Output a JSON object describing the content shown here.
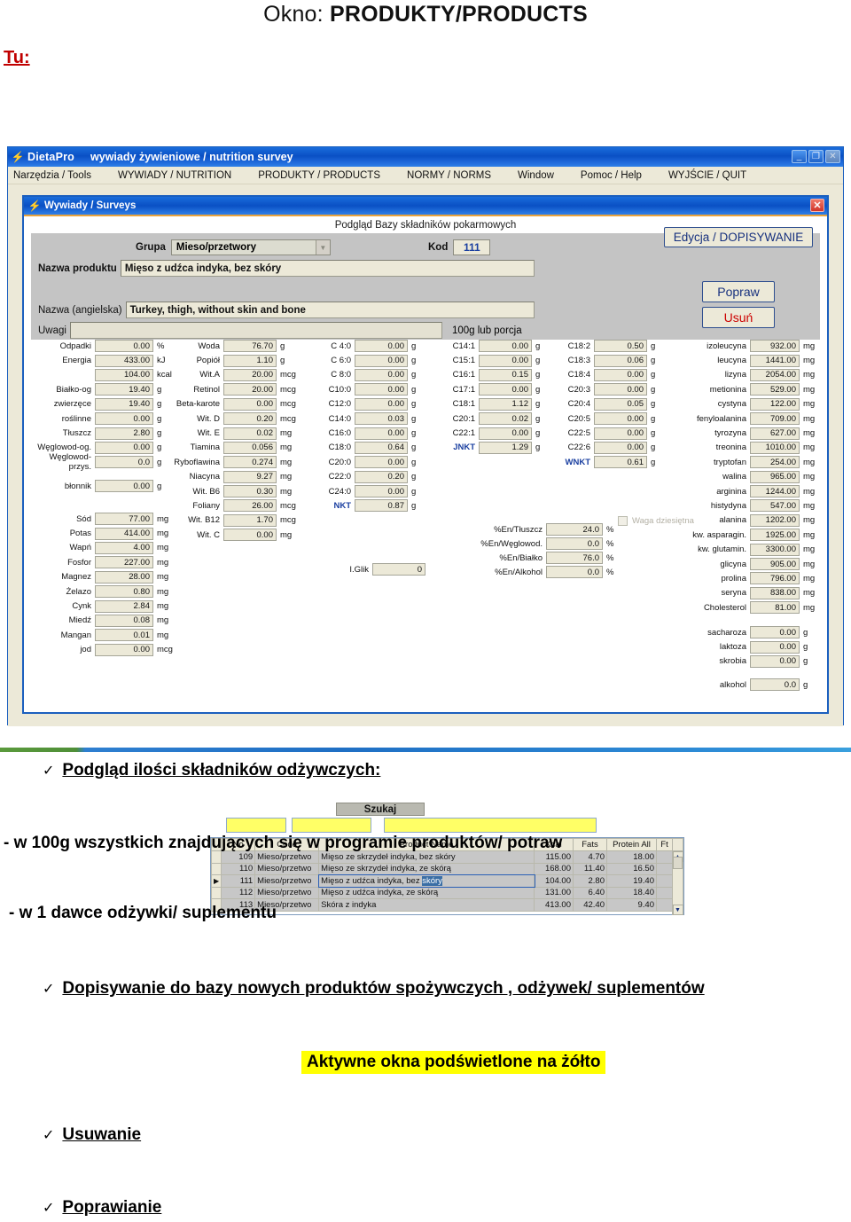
{
  "slide": {
    "title_prefix": "Okno: ",
    "title_main": "PRODUKTY/PRODUCTS",
    "tu_label": "Tu:"
  },
  "app": {
    "icon": "lightning-bolt-icon",
    "name": "DietaPro",
    "subtitle": "wywiady żywieniowe / nutrition survey",
    "window_buttons": {
      "minimize": "_",
      "restore": "❐",
      "close": "✕"
    },
    "menu": [
      "Narzędzia / Tools",
      "WYWIADY / NUTRITION",
      "PRODUKTY / PRODUCTS",
      "NORMY / NORMS",
      "Window",
      "Pomoc / Help",
      "WYJŚCIE / QUIT"
    ]
  },
  "child_window": {
    "title": "Wywiady / Surveys",
    "close": "✕",
    "preview_caption": "Podgląd Bazy składników pokarmowych"
  },
  "form": {
    "grupa_label": "Grupa",
    "grupa_value": "Mieso/przetwory",
    "kod_label": "Kod",
    "kod_value": "111",
    "nazwa_label": "Nazwa produktu",
    "nazwa_value": "Mięso z udźca indyka, bez skóry",
    "eng_label": "Nazwa (angielska)",
    "eng_value": "Turkey, thigh, without skin and bone",
    "uwagi_label": "Uwagi",
    "uwagi_value": "",
    "portion_note": "100g lub porcja"
  },
  "buttons": {
    "edycja": "Edycja / DOPISYWANIE",
    "popraw": "Popraw",
    "usun": "Usuń",
    "szukaj": "Szukaj"
  },
  "search_fields": [
    "",
    "",
    ""
  ],
  "checkbox": {
    "label": "Waga dziesiętna",
    "checked": false
  },
  "nutrients": {
    "col1": [
      {
        "label": "Odpadki",
        "value": "0.00",
        "unit": "%"
      },
      {
        "label": "Energia",
        "value": "433.00",
        "unit": "kJ"
      },
      {
        "label": "",
        "value": "104.00",
        "unit": "kcal"
      },
      {
        "label": "Białko-og",
        "value": "19.40",
        "unit": "g"
      },
      {
        "label": "zwierzęce",
        "value": "19.40",
        "unit": "g"
      },
      {
        "label": "roślinne",
        "value": "0.00",
        "unit": "g"
      },
      {
        "label": "Tłuszcz",
        "value": "2.80",
        "unit": "g"
      },
      {
        "label": "Węglowod-og.",
        "value": "0.00",
        "unit": "g"
      },
      {
        "label": "Węglowod-przys.",
        "value": "0.0",
        "unit": "g"
      }
    ],
    "col1b": [
      {
        "label": "błonnik",
        "value": "0.00",
        "unit": "g"
      }
    ],
    "col1c": [
      {
        "label": "Sód",
        "value": "77.00",
        "unit": "mg"
      },
      {
        "label": "Potas",
        "value": "414.00",
        "unit": "mg"
      },
      {
        "label": "Wapń",
        "value": "4.00",
        "unit": "mg"
      },
      {
        "label": "Fosfor",
        "value": "227.00",
        "unit": "mg"
      },
      {
        "label": "Magnez",
        "value": "28.00",
        "unit": "mg"
      },
      {
        "label": "Żelazo",
        "value": "0.80",
        "unit": "mg"
      },
      {
        "label": "Cynk",
        "value": "2.84",
        "unit": "mg"
      },
      {
        "label": "Miedź",
        "value": "0.08",
        "unit": "mg"
      },
      {
        "label": "Mangan",
        "value": "0.01",
        "unit": "mg"
      },
      {
        "label": "jod",
        "value": "0.00",
        "unit": "mcg"
      }
    ],
    "col2": [
      {
        "label": "Woda",
        "value": "76.70",
        "unit": "g"
      },
      {
        "label": "Popiół",
        "value": "1.10",
        "unit": "g"
      },
      {
        "label": "Wit.A",
        "value": "20.00",
        "unit": "mcg"
      },
      {
        "label": "Retinol",
        "value": "20.00",
        "unit": "mcg"
      },
      {
        "label": "Beta-karote",
        "value": "0.00",
        "unit": "mcg"
      },
      {
        "label": "Wit. D",
        "value": "0.20",
        "unit": "mcg"
      },
      {
        "label": "Wit. E",
        "value": "0.02",
        "unit": "mg"
      },
      {
        "label": "Tiamina",
        "value": "0.056",
        "unit": "mg"
      },
      {
        "label": "Ryboflawina",
        "value": "0.274",
        "unit": "mg"
      },
      {
        "label": "Niacyna",
        "value": "9.27",
        "unit": "mg"
      },
      {
        "label": "Wit. B6",
        "value": "0.30",
        "unit": "mg"
      },
      {
        "label": "Foliany",
        "value": "26.00",
        "unit": "mcg"
      },
      {
        "label": "Wit. B12",
        "value": "1.70",
        "unit": "mcg"
      },
      {
        "label": "Wit. C",
        "value": "0.00",
        "unit": "mg"
      }
    ],
    "col3": [
      {
        "label": "C 4:0",
        "value": "0.00",
        "unit": "g"
      },
      {
        "label": "C 6:0",
        "value": "0.00",
        "unit": "g"
      },
      {
        "label": "C 8:0",
        "value": "0.00",
        "unit": "g"
      },
      {
        "label": "C10:0",
        "value": "0.00",
        "unit": "g"
      },
      {
        "label": "C12:0",
        "value": "0.00",
        "unit": "g"
      },
      {
        "label": "C14:0",
        "value": "0.03",
        "unit": "g"
      },
      {
        "label": "C16:0",
        "value": "0.00",
        "unit": "g"
      },
      {
        "label": "C18:0",
        "value": "0.64",
        "unit": "g"
      },
      {
        "label": "C20:0",
        "value": "0.00",
        "unit": "g"
      },
      {
        "label": "C22:0",
        "value": "0.20",
        "unit": "g"
      },
      {
        "label": "C24:0",
        "value": "0.00",
        "unit": "g"
      },
      {
        "label": "NKT",
        "value": "0.87",
        "unit": "g",
        "accent": true
      }
    ],
    "col4": [
      {
        "label": "C14:1",
        "value": "0.00",
        "unit": "g"
      },
      {
        "label": "C15:1",
        "value": "0.00",
        "unit": "g"
      },
      {
        "label": "C16:1",
        "value": "0.15",
        "unit": "g"
      },
      {
        "label": "C17:1",
        "value": "0.00",
        "unit": "g"
      },
      {
        "label": "C18:1",
        "value": "1.12",
        "unit": "g"
      },
      {
        "label": "C20:1",
        "value": "0.02",
        "unit": "g"
      },
      {
        "label": "C22:1",
        "value": "0.00",
        "unit": "g"
      },
      {
        "label": "JNKT",
        "value": "1.29",
        "unit": "g",
        "accent": true
      }
    ],
    "col5": [
      {
        "label": "C18:2",
        "value": "0.50",
        "unit": "g"
      },
      {
        "label": "C18:3",
        "value": "0.06",
        "unit": "g"
      },
      {
        "label": "C18:4",
        "value": "0.00",
        "unit": "g"
      },
      {
        "label": "C20:3",
        "value": "0.00",
        "unit": "g"
      },
      {
        "label": "C20:4",
        "value": "0.05",
        "unit": "g"
      },
      {
        "label": "C20:5",
        "value": "0.00",
        "unit": "g"
      },
      {
        "label": "C22:5",
        "value": "0.00",
        "unit": "g"
      },
      {
        "label": "C22:6",
        "value": "0.00",
        "unit": "g"
      },
      {
        "label": "WNKT",
        "value": "0.61",
        "unit": "g",
        "accent": true
      }
    ],
    "col6": [
      {
        "label": "izoleucyna",
        "value": "932.00",
        "unit": "mg"
      },
      {
        "label": "leucyna",
        "value": "1441.00",
        "unit": "mg"
      },
      {
        "label": "lizyna",
        "value": "2054.00",
        "unit": "mg"
      },
      {
        "label": "metionina",
        "value": "529.00",
        "unit": "mg"
      },
      {
        "label": "cystyna",
        "value": "122.00",
        "unit": "mg"
      },
      {
        "label": "fenyloalanina",
        "value": "709.00",
        "unit": "mg"
      },
      {
        "label": "tyrozyna",
        "value": "627.00",
        "unit": "mg"
      },
      {
        "label": "treonina",
        "value": "1010.00",
        "unit": "mg"
      },
      {
        "label": "tryptofan",
        "value": "254.00",
        "unit": "mg"
      },
      {
        "label": "walina",
        "value": "965.00",
        "unit": "mg"
      },
      {
        "label": "arginina",
        "value": "1244.00",
        "unit": "mg"
      },
      {
        "label": "histydyna",
        "value": "547.00",
        "unit": "mg"
      },
      {
        "label": "alanina",
        "value": "1202.00",
        "unit": "mg"
      },
      {
        "label": "kw. asparagin.",
        "value": "1925.00",
        "unit": "mg"
      },
      {
        "label": "kw. glutamin.",
        "value": "3300.00",
        "unit": "mg"
      },
      {
        "label": "glicyna",
        "value": "905.00",
        "unit": "mg"
      },
      {
        "label": "prolina",
        "value": "796.00",
        "unit": "mg"
      },
      {
        "label": "seryna",
        "value": "838.00",
        "unit": "mg"
      },
      {
        "label": "Cholesterol",
        "value": "81.00",
        "unit": "mg"
      }
    ],
    "col6b": [
      {
        "label": "sacharoza",
        "value": "0.00",
        "unit": "g"
      },
      {
        "label": "laktoza",
        "value": "0.00",
        "unit": "g"
      },
      {
        "label": "skrobia",
        "value": "0.00",
        "unit": "g"
      }
    ],
    "col6c": [
      {
        "label": "alkohol",
        "value": "0.0",
        "unit": "g"
      }
    ],
    "energy_pct": [
      {
        "label": "%En/Tłuszcz",
        "value": "24.0",
        "unit": "%"
      },
      {
        "label": "%En/Węglowod.",
        "value": "0.0",
        "unit": "%"
      },
      {
        "label": "%En/Białko",
        "value": "76.0",
        "unit": "%"
      },
      {
        "label": "%En/Alkohol",
        "value": "0.0",
        "unit": "%"
      }
    ],
    "iglik": {
      "label": "I.Glik",
      "value": "0"
    }
  },
  "product_grid": {
    "headers": [
      "No",
      "Code",
      "Product Name",
      "Kcal",
      "Fats",
      "Protein All",
      "Ft"
    ],
    "rows": [
      {
        "no": "109",
        "code": "Mieso/przetwo",
        "name": "Mięso ze skrzydeł indyka, bez skóry",
        "kcal": "115.00",
        "fats": "4.70",
        "protein": "18.00",
        "ft": ""
      },
      {
        "no": "110",
        "code": "Mieso/przetwo",
        "name": "Mięso ze skrzydeł indyka, ze skórą",
        "kcal": "168.00",
        "fats": "11.40",
        "protein": "16.50",
        "ft": ""
      },
      {
        "no": "111",
        "code": "Mieso/przetwo",
        "name": "Mięso z udźca indyka, bez skóry",
        "kcal": "104.00",
        "fats": "2.80",
        "protein": "19.40",
        "ft": "",
        "selected": true
      },
      {
        "no": "112",
        "code": "Mieso/przetwo",
        "name": "Mięso z udźca indyka, ze skórą",
        "kcal": "131.00",
        "fats": "6.40",
        "protein": "18.40",
        "ft": ""
      },
      {
        "no": "113",
        "code": "Mieso/przetwo",
        "name": "Skóra z indyka",
        "kcal": "413.00",
        "fats": "42.40",
        "protein": "9.40",
        "ft": ""
      }
    ],
    "selected_row_name_prefix": "Mięso z udźca indyka, bez ",
    "selected_row_name_highlight": "skóry"
  },
  "notes": {
    "b1": "Podgląd ilości składników odżywczych:",
    "line1": "- w 100g wszystkich znajdujących się w programie produktów/ potraw",
    "line2": "- w 1 dawce odżywki/ suplementu",
    "b2": "Dopisywanie do bazy nowych produktów spożywczych , odżywek/ suplementów",
    "highlight": "Aktywne okna podświetlone na żółto",
    "b3": "Usuwanie",
    "b4": "Poprawianie",
    "tick": "✓"
  },
  "colors": {
    "accent_blue": "#1a3fa0",
    "title_blue": "#0a50c4",
    "danger_red": "#cc0000",
    "highlight_yellow": "#ffff00",
    "field_beige": "#ece9d8"
  }
}
